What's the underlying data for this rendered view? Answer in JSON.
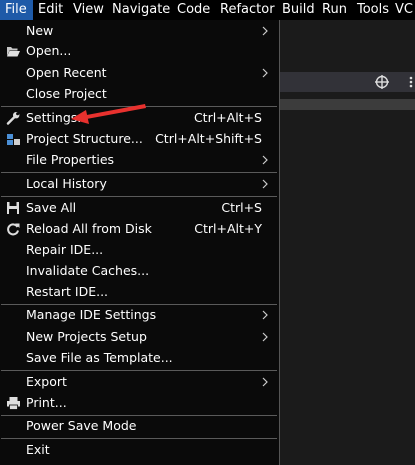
{
  "menubar": {
    "file": "File",
    "edit": "Edit",
    "view": "View",
    "navigate": "Navigate",
    "code": "Code",
    "refactor": "Refactor",
    "build": "Build",
    "run": "Run",
    "tools": "Tools",
    "vcs": "VC"
  },
  "file_menu": {
    "new": "New",
    "open": "Open...",
    "open_recent": "Open Recent",
    "close_project": "Close Project",
    "settings": {
      "label": "Settings...",
      "shortcut": "Ctrl+Alt+S"
    },
    "project_structure": {
      "label": "Project Structure...",
      "shortcut": "Ctrl+Alt+Shift+S"
    },
    "file_properties": "File Properties",
    "local_history": "Local History",
    "save_all": {
      "label": "Save All",
      "shortcut": "Ctrl+S"
    },
    "reload_all": {
      "label": "Reload All from Disk",
      "shortcut": "Ctrl+Alt+Y"
    },
    "repair_ide": "Repair IDE...",
    "invalidate_caches": "Invalidate Caches...",
    "restart_ide": "Restart IDE...",
    "manage_ide_settings": "Manage IDE Settings",
    "new_projects_setup": "New Projects Setup",
    "save_file_as_template": "Save File as Template...",
    "export": "Export",
    "print": "Print...",
    "power_save_mode": "Power Save Mode",
    "exit": "Exit"
  },
  "colors": {
    "menubar_active": "#1e5aa8",
    "annotation_arrow": "#e8312e",
    "menu_bg": "#0a0a0a",
    "separator": "#5a5a5a"
  }
}
